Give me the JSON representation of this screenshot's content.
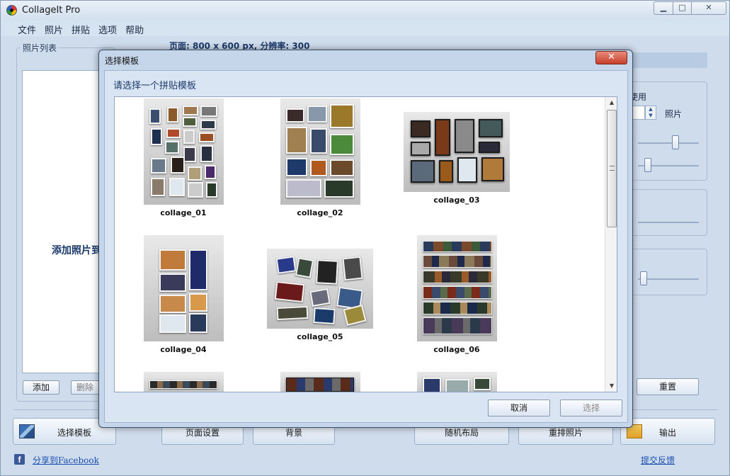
{
  "window": {
    "title": "CollageIt Pro",
    "controls": {
      "minimize": "▁",
      "maximize": "□",
      "close": "✕"
    }
  },
  "menu": [
    "文件",
    "照片",
    "拼贴",
    "选项",
    "帮助"
  ],
  "photo_list": {
    "legend": "照片列表",
    "hint": "添加照片到",
    "add_label": "添加",
    "delete_label": "删除"
  },
  "page_info": "页面: 800 x 600 px, 分辨率: 300",
  "right_panel": {
    "use_label": "使用",
    "photo_label": "照片",
    "reset_label": "重置"
  },
  "toolbar": {
    "select_template": "选择模板",
    "page_settings": "页面设置",
    "background": "背景",
    "random_layout": "随机布局",
    "reorder_photos": "重排照片",
    "output": "输出"
  },
  "footer": {
    "share": "分享到Facebook",
    "feedback": "提交反馈"
  },
  "dialog": {
    "title": "选择模板",
    "close": "✕",
    "prompt": "请选择一个拼贴模板",
    "cancel": "取消",
    "select": "选择",
    "templates": [
      {
        "name": "collage_01"
      },
      {
        "name": "collage_02"
      },
      {
        "name": "collage_03"
      },
      {
        "name": "collage_04"
      },
      {
        "name": "collage_05"
      },
      {
        "name": "collage_06"
      }
    ]
  },
  "colors": {
    "window_bg": "#cfdcec",
    "dialog_close": "#c6402b",
    "link": "#1a4fb0"
  }
}
